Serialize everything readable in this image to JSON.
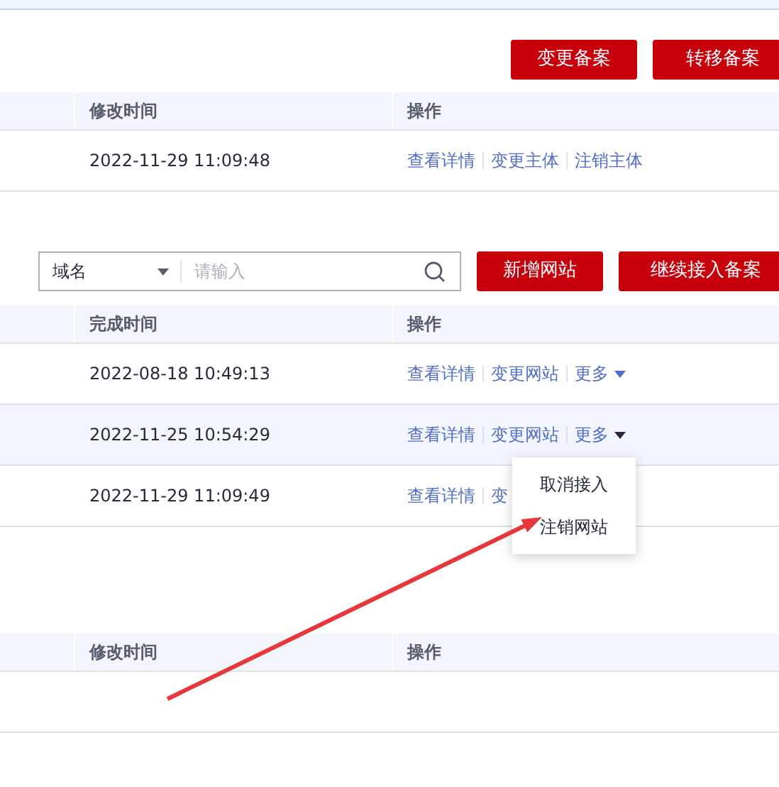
{
  "top_buttons": [
    "变更备案",
    "转移备案"
  ],
  "table_1": {
    "columns": [
      "修改时间",
      "操作"
    ],
    "rows": [
      {
        "time": "2022-11-29 11:09:48",
        "selected": false,
        "actions": [
          {
            "label": "查看详情",
            "kind": "link"
          },
          {
            "label": "变更主体",
            "kind": "link"
          },
          {
            "label": "注销主体",
            "kind": "link"
          }
        ]
      }
    ]
  },
  "search": {
    "select": "域名",
    "placeholder": "请输入"
  },
  "site_buttons": [
    "新增网站",
    "继续接入备案"
  ],
  "table_2": {
    "columns": [
      "完成时间",
      "操作"
    ],
    "rows": [
      {
        "time": "2022-08-18 10:49:13",
        "selected": false,
        "actions": [
          {
            "label": "查看详情",
            "kind": "link"
          },
          {
            "label": "变更网站",
            "kind": "link"
          },
          {
            "label": "更多",
            "kind": "more",
            "expanded": false
          }
        ]
      },
      {
        "time": "2022-11-25 10:54:29",
        "selected": true,
        "actions": [
          {
            "label": "查看详情",
            "kind": "link"
          },
          {
            "label": "变更网站",
            "kind": "link"
          },
          {
            "label": "更多",
            "kind": "more",
            "expanded": true
          }
        ]
      },
      {
        "time": "2022-11-29 11:09:49",
        "selected": false,
        "actions": [
          {
            "label": "查看详情",
            "kind": "link"
          },
          {
            "label": "变",
            "kind": "link"
          }
        ]
      }
    ]
  },
  "more_menu": [
    "取消接入",
    "注销网站"
  ],
  "table_3": {
    "columns": [
      "修改时间",
      "操作"
    ]
  }
}
